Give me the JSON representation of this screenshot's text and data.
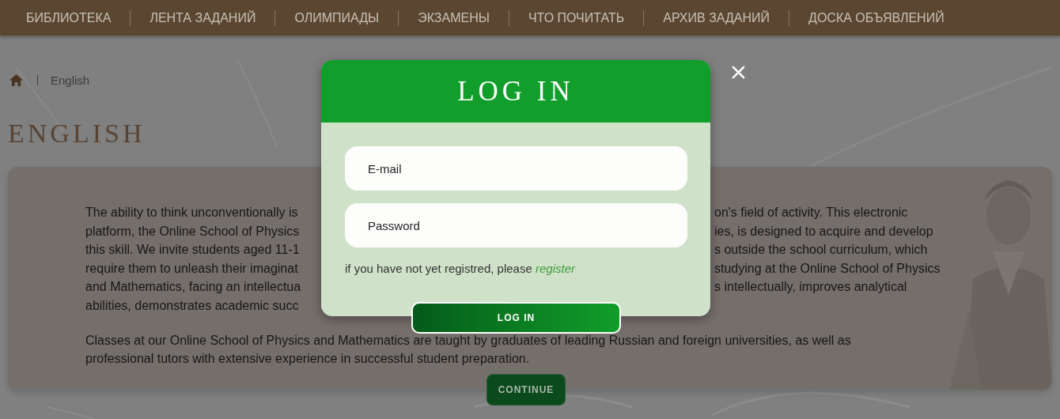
{
  "nav": [
    "БИБЛИОТЕКА",
    "ЛЕНТА ЗАДАНИЙ",
    "ОЛИМПИАДЫ",
    "ЭКЗАМЕНЫ",
    "ЧТО ПОЧИТАТЬ",
    "АРХИВ ЗАДАНИЙ",
    "ДОСКА ОБЪЯВЛЕНИЙ"
  ],
  "breadcrumb": [
    "English"
  ],
  "heading": "ENGLISH",
  "paragraphs": [
    {
      "lines": [
        {
          "left": "The ability to think unconventionally is",
          "right": "on's field of activity. This electronic"
        },
        {
          "left": "platform, the Online School of Physics",
          "right": "ies, is designed to acquire and develop"
        },
        {
          "left": "this skill. We invite students aged 11-1",
          "right": "s outside the school curriculum, which"
        },
        {
          "left": "require them to unleash their imaginat",
          "right": "studying at the Online School of Physics"
        },
        {
          "left": "and Mathematics, facing an intellectua",
          "right": "s intellectually, improves analytical"
        },
        {
          "left": "abilities, demonstrates academic succ"
        }
      ]
    },
    {
      "lines": [
        {
          "left": "Classes at our Online School of Physics and Mathematics are taught by graduates of leading Russian and foreign universities, as well as"
        },
        {
          "left": "professional tutors with extensive experience in successful student preparation."
        }
      ]
    }
  ],
  "continue_button": "CONTINUE",
  "modal": {
    "title": "LOG IN",
    "fields": [
      {
        "placeholder": "E-mail"
      },
      {
        "placeholder": "Password"
      }
    ],
    "note": "if you have not yet registred, please",
    "register_link": "register",
    "submit": "LOG IN"
  }
}
